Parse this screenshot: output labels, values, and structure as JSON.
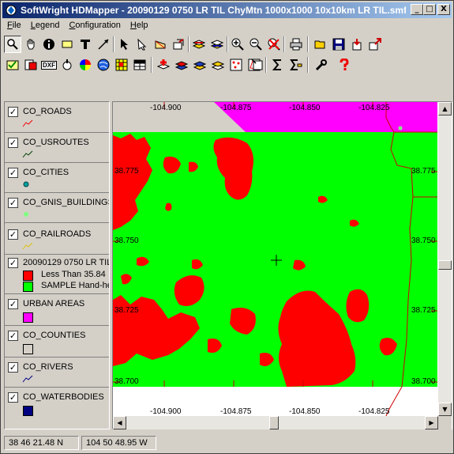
{
  "window": {
    "title": "SoftWright HDMapper - 20090129 0750 LR TIL ChyMtn 1000x1000 10x10km LR TIL.smf",
    "minimize_label": "_",
    "maximize_label": "□",
    "close_label": "X"
  },
  "menu": [
    {
      "label": "File"
    },
    {
      "label": "Legend"
    },
    {
      "label": "Configuration"
    },
    {
      "label": "Help"
    }
  ],
  "toolbar1_icons": [
    "zoom-icon",
    "pan-hand-icon",
    "info-icon",
    "label-icon",
    "text-tool-icon",
    "measure-icon",
    "select-arrow-icon",
    "edit-pointer-icon",
    "area-icon",
    "export-icon",
    "layers-up-icon",
    "layers-down-icon",
    "zoom-in-icon",
    "zoom-out-icon",
    "zoom-cancel-icon",
    "print-icon",
    "open-folder-icon",
    "save-icon",
    "import-icon",
    "export-out-icon"
  ],
  "toolbar2_icons": [
    "check-icon",
    "database-icon",
    "dxf-icon",
    "hand-drag-icon",
    "color-wheel-icon",
    "globe-icon",
    "grid-icon",
    "table-icon",
    "add-site-icon",
    "stack-red-icon",
    "stack-blue-icon",
    "stack-yellow-icon",
    "points-icon",
    "polygon-icon",
    "properties-icon",
    "sum-icon",
    "sum-edit-icon",
    "tools-icon",
    "help-icon"
  ],
  "toolbar2_dxf_label": "DXF",
  "legend": {
    "layers": [
      {
        "name": "CO_ROADS",
        "checked": true
      },
      {
        "name": "CO_USROUTES",
        "checked": true
      },
      {
        "name": "CO_CITIES",
        "checked": true
      },
      {
        "name": "CO_GNIS_BUILDINGS",
        "checked": true
      },
      {
        "name": "CO_RAILROADS",
        "checked": true
      },
      {
        "name": "20090129 0750 LR TIL",
        "checked": true,
        "items": [
          {
            "label": "Less Than 35.84",
            "color": "#ff0000"
          },
          {
            "label": "SAMPLE Hand-he",
            "color": "#00ff00"
          }
        ]
      },
      {
        "name": "URBAN AREAS",
        "checked": true,
        "color": "#ff00ff"
      },
      {
        "name": "CO_COUNTIES",
        "checked": true,
        "color": "#d4d0c8"
      },
      {
        "name": "CO_RIVERS",
        "checked": true
      },
      {
        "name": "CO_WATERBODIES",
        "checked": true,
        "color": "#000080"
      }
    ],
    "check_mark": "✓"
  },
  "map": {
    "top_coords": [
      "-104.900",
      "-104.875",
      "-104.850",
      "-104.825"
    ],
    "bottom_coords": [
      "-104.900",
      "-104.875",
      "-104.850",
      "-104.825"
    ],
    "left_coords": [
      "38.775",
      "38.750",
      "38.725",
      "38.700"
    ],
    "right_coords": [
      "38.775",
      "38.750",
      "38.725",
      "38.700"
    ],
    "coverage_color": "#00ff00",
    "loss_color": "#ff0000",
    "urban_color": "#ff00ff",
    "road_color": "#cc0000"
  },
  "status": {
    "latitude": "38 46 21.48 N",
    "longitude": "104 50 48.95 W"
  }
}
